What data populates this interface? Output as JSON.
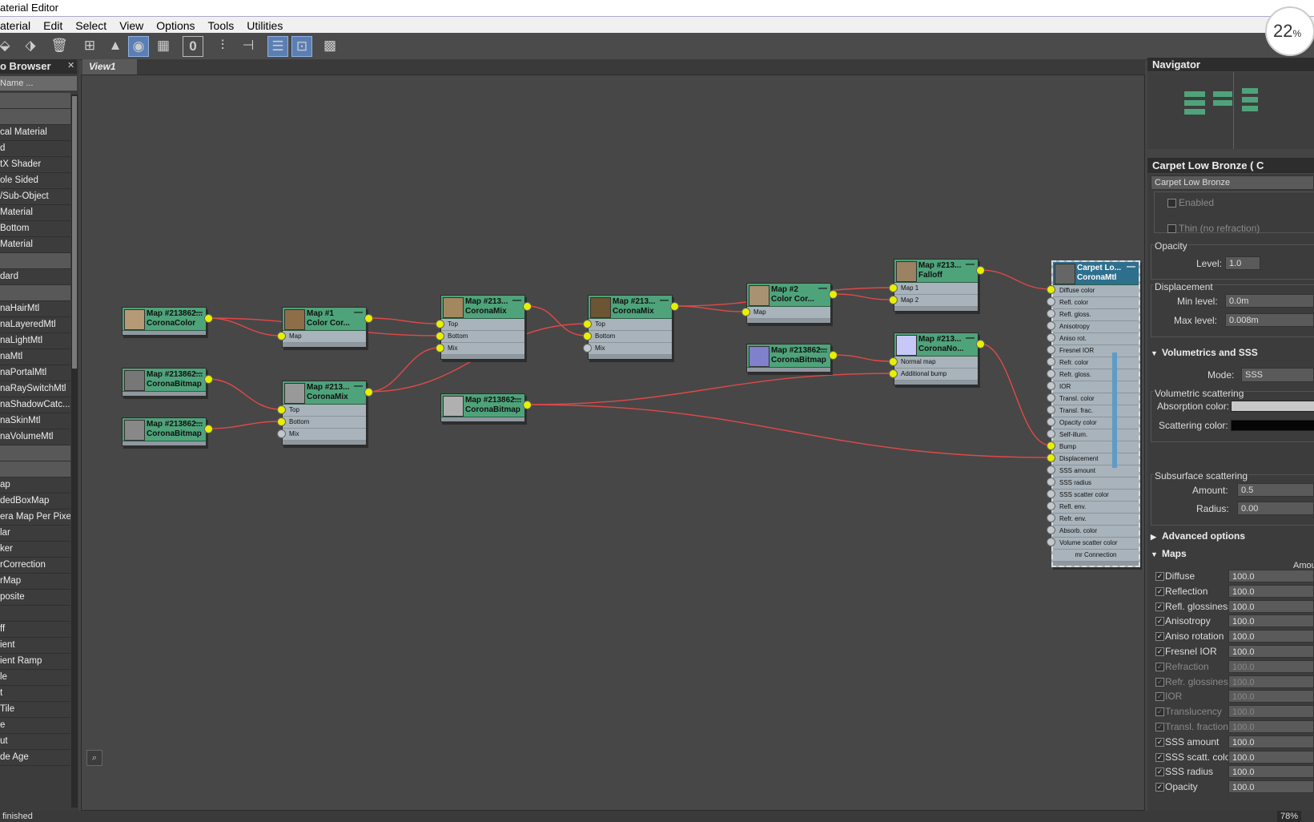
{
  "window": {
    "title": "aterial Editor"
  },
  "menu": [
    "aterial",
    "Edit",
    "Select",
    "View",
    "Options",
    "Tools",
    "Utilities"
  ],
  "toolbar": {
    "zero_label": "0"
  },
  "zoom_badge": {
    "value": "22",
    "unit": "%"
  },
  "browser": {
    "title": "o Browser",
    "search_placeholder": "Name ...",
    "items": [
      {
        "label": "",
        "header": true
      },
      {
        "label": "",
        "header": true
      },
      {
        "label": "cal Material"
      },
      {
        "label": "d"
      },
      {
        "label": "tX Shader"
      },
      {
        "label": "ole Sided"
      },
      {
        "label": "/Sub-Object"
      },
      {
        "label": " Material"
      },
      {
        "label": "Bottom"
      },
      {
        "label": " Material"
      },
      {
        "label": "",
        "header": true
      },
      {
        "label": "dard"
      },
      {
        "label": "",
        "header": true
      },
      {
        "label": "naHairMtl"
      },
      {
        "label": "naLayeredMtl"
      },
      {
        "label": "naLightMtl"
      },
      {
        "label": "naMtl"
      },
      {
        "label": "naPortalMtl"
      },
      {
        "label": "naRaySwitchMtl"
      },
      {
        "label": "naShadowCatc..."
      },
      {
        "label": "naSkinMtl"
      },
      {
        "label": "naVolumeMtl"
      },
      {
        "label": "",
        "header": true
      },
      {
        "label": "",
        "header": true
      },
      {
        "label": "ap"
      },
      {
        "label": "dedBoxMap"
      },
      {
        "label": "era Map Per Pixel"
      },
      {
        "label": "lar"
      },
      {
        "label": "ker"
      },
      {
        "label": "rCorrection"
      },
      {
        "label": "rMap"
      },
      {
        "label": "posite"
      },
      {
        "label": ""
      },
      {
        "label": "ff"
      },
      {
        "label": "ient"
      },
      {
        "label": "ient Ramp"
      },
      {
        "label": "le"
      },
      {
        "label": "t"
      },
      {
        "label": "Tile"
      },
      {
        "label": "e"
      },
      {
        "label": "ut"
      },
      {
        "label": "de Age"
      }
    ]
  },
  "view": {
    "tab": "View1"
  },
  "nodes": {
    "corona_color": {
      "title": "Map #213862...",
      "type": "CoronaColor",
      "swatch": "#b59a76",
      "slots": []
    },
    "color_correct": {
      "title": "Map #1",
      "type": "Color Cor...",
      "swatch": "#8d6e48",
      "slots": [
        "Map"
      ]
    },
    "mix1": {
      "title": "Map #213...",
      "type": "CoronaMix",
      "swatch": "#a2875f",
      "slots": [
        "Top",
        "Bottom",
        "Mix"
      ]
    },
    "mix2": {
      "title": "Map #213...",
      "type": "CoronaMix",
      "swatch": "#6b5533",
      "slots": [
        "Top",
        "Bottom",
        "Mix"
      ]
    },
    "color_correct2": {
      "title": "Map #2",
      "type": "Color Cor...",
      "swatch": "#a89272",
      "slots": [
        "Map"
      ]
    },
    "falloff": {
      "title": "Map #213...",
      "type": "Falloff",
      "swatch": "#9a8262",
      "slots": [
        "Map 1",
        "Map 2"
      ]
    },
    "bitmap1": {
      "title": "Map #213862...",
      "type": "CoronaBitmap",
      "swatch": "#777777",
      "slots": []
    },
    "bitmap2": {
      "title": "Map #213862...",
      "type": "CoronaBitmap",
      "swatch": "#888888",
      "slots": []
    },
    "mix3": {
      "title": "Map #213...",
      "type": "CoronaMix",
      "swatch": "#999999",
      "slots": [
        "Top",
        "Bottom",
        "Mix"
      ]
    },
    "bitmap3": {
      "title": "Map #213862...",
      "type": "CoronaBitmap",
      "swatch": "#b0b0b0",
      "slots": []
    },
    "bitmap_blue": {
      "title": "Map #213862...",
      "type": "CoronaBitmap",
      "swatch": "#8080cc",
      "slots": []
    },
    "normal": {
      "title": "Map #213...",
      "type": "CoronaNo...",
      "swatch": "#c8c8f8",
      "slots": [
        "Normal map",
        "Additional bump"
      ]
    },
    "carpet": {
      "title": "Carpet Lo...",
      "type": "CoronaMtl",
      "swatch": "#666666",
      "slots": [
        "Diffuse color",
        "Refl. color",
        "Refl. gloss.",
        "Anisotropy",
        "Aniso rot.",
        "Fresnel IOR",
        "Refr. color",
        "Refr. gloss.",
        "IOR",
        "Transl. color",
        "Transl. frac.",
        "Opacity color",
        "Self-illum.",
        "Bump",
        "Displacement",
        "SSS amount",
        "SSS radius",
        "SSS scatter color",
        "Refl. env.",
        "Refr. env.",
        "Absorb. color",
        "Volume scatter color"
      ],
      "footer": "mr Connection"
    }
  },
  "navigator": {
    "title": "Navigator"
  },
  "props": {
    "title": "Carpet Low Bronze  ( C",
    "name_field": "Carpet Low Bronze",
    "enabled_label": "Enabled",
    "thin_label": "Thin (no refraction)",
    "opacity_header": "Opacity",
    "level_label": "Level:",
    "level_value": "1.0",
    "displacement_header": "Displacement",
    "min_level_label": "Min level:",
    "min_level_value": "0.0m",
    "max_level_label": "Max level:",
    "max_level_value": "0.008m",
    "volumetrics_section": "Volumetrics and SSS",
    "mode_label": "Mode:",
    "mode_value": "SSS",
    "volumetric_scattering": "Volumetric scattering",
    "absorption_label": "Absorption color:",
    "absorption_color": "#c8c8c8",
    "scattering_label": "Scattering color:",
    "scattering_color": "#050505",
    "subsurface_header": "Subsurface scattering",
    "amount_label": "Amount:",
    "amount_value": "0.5",
    "radius_label": "Radius:",
    "radius_value": "0.00",
    "advanced_section": "Advanced options",
    "maps_section": "Maps",
    "amount_col": "Amou",
    "maps": [
      {
        "label": "Diffuse",
        "value": "100.0",
        "enabled": true
      },
      {
        "label": "Reflection",
        "value": "100.0",
        "enabled": true
      },
      {
        "label": "Refl. glossiness",
        "value": "100.0",
        "enabled": true
      },
      {
        "label": "Anisotropy",
        "value": "100.0",
        "enabled": true
      },
      {
        "label": "Aniso rotation",
        "value": "100.0",
        "enabled": true
      },
      {
        "label": "Fresnel IOR",
        "value": "100.0",
        "enabled": true
      },
      {
        "label": "Refraction",
        "value": "100.0",
        "enabled": false
      },
      {
        "label": "Refr. glossiness",
        "value": "100.0",
        "enabled": false
      },
      {
        "label": "IOR",
        "value": "100.0",
        "enabled": false
      },
      {
        "label": "Translucency",
        "value": "100.0",
        "enabled": false
      },
      {
        "label": "Transl. fraction",
        "value": "100.0",
        "enabled": false
      },
      {
        "label": "SSS amount",
        "value": "100.0",
        "enabled": true
      },
      {
        "label": "SSS scatt. color",
        "value": "100.0",
        "enabled": true
      },
      {
        "label": "SSS radius",
        "value": "100.0",
        "enabled": true
      },
      {
        "label": "Opacity",
        "value": "100.0",
        "enabled": true
      }
    ]
  },
  "status": {
    "text": "finished",
    "zoom": "78%"
  },
  "colors": {
    "node_header": "#4fa37a",
    "wire": "#e04848",
    "socket": "#e8f000",
    "selected_header": "#2e6f8e"
  }
}
